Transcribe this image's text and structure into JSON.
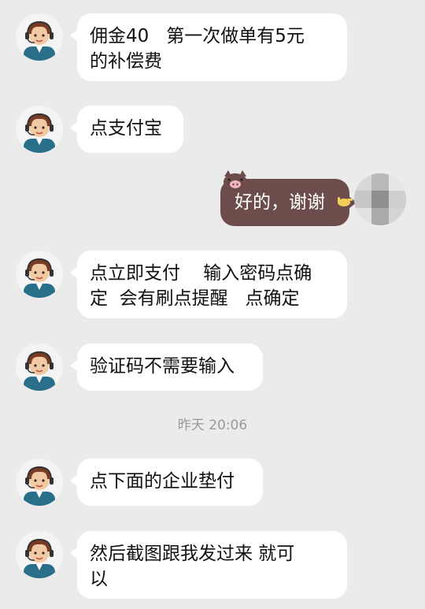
{
  "messages": [
    {
      "from": "agent",
      "text": "佣金40   第一次做单有5元\n的补偿费"
    },
    {
      "from": "agent",
      "text": "点支付宝"
    },
    {
      "from": "me",
      "text": "好的，谢谢"
    },
    {
      "from": "agent",
      "text": "点立即支付    输入密码点确\n定  会有刷点提醒   点确定"
    },
    {
      "from": "agent",
      "text": "验证码不需要输入"
    },
    {
      "from": "agent",
      "text": "点下面的企业垫付"
    },
    {
      "from": "agent",
      "text": "然后截图跟我发过来 就可\n以"
    }
  ],
  "timestamp": "昨天 20:06",
  "colors": {
    "background": "#ebebeb",
    "incoming_bubble": "#ffffff",
    "outgoing_bubble": "#6d4d4b",
    "timestamp_text": "#9a9a9a"
  },
  "icons": {
    "agent_avatar": "customer-service-agent-avatar-icon",
    "self_avatar": "blurred-user-avatar-icon",
    "bubble_decoration": "pig-face-icon"
  }
}
